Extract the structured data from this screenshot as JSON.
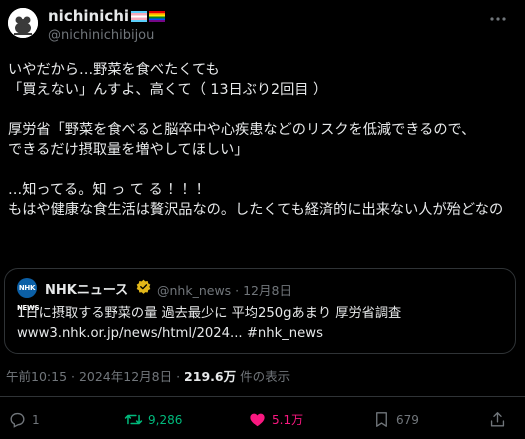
{
  "author": {
    "display_name": "nichinichi",
    "handle": "@nichinichibijou",
    "flags": [
      "transgender-flag",
      "rainbow-flag"
    ]
  },
  "tweet": {
    "lines": [
      "いやだから…野菜を食べたくても",
      "「買えない」んすよ、高くて（ 13日ぶり2回目 ）",
      "厚労省「野菜を食べると脳卒中や心疾患などのリスクを低減できるので、",
      "できるだけ摂取量を増やしてほしい」",
      "…知ってる。知 っ て る ！！！",
      "もはや健康な食生活は贅沢品なの。したくても経済的に出来ない人が殆どなの"
    ]
  },
  "quote": {
    "logo_text": "NHK NEWS",
    "name": "NHKニュース",
    "meta": "@nhk_news · 12月8日",
    "line1": "1日に摂取する野菜の量 過去最少に 平均250gあまり 厚労省調査",
    "line2": "www3.nhk.or.jp/news/html/2024... #nhk_news"
  },
  "timestamp": {
    "date": "午前10:15 · 2024年12月8日 · ",
    "views": "219.6万",
    "views_suffix": " 件の表示"
  },
  "actions": {
    "replies": "1",
    "retweets": "9,286",
    "likes": "5.1万",
    "bookmarks": "679"
  },
  "colors": {
    "background": "#000000",
    "text": "#e7e9ea",
    "muted": "#71767b",
    "retweet": "#00ba7c",
    "like": "#f91880",
    "verified": "#e2b719",
    "border": "#2f3336"
  }
}
